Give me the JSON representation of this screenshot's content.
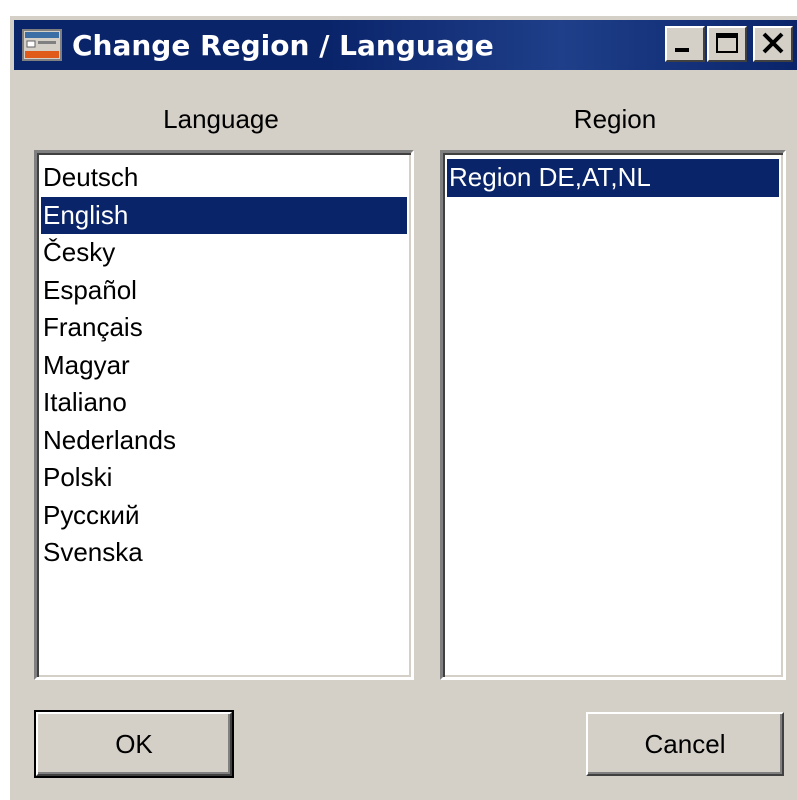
{
  "window": {
    "title": "Change Region / Language"
  },
  "language": {
    "label": "Language",
    "items": [
      "Deutsch",
      "English",
      "Česky",
      "Español",
      "Français",
      "Magyar",
      "Italiano",
      "Nederlands",
      "Polski",
      "Русский",
      "Svenska"
    ],
    "selected": "English"
  },
  "region": {
    "label": "Region",
    "items": [
      "Region DE,AT,NL"
    ],
    "selected": "Region DE,AT,NL"
  },
  "buttons": {
    "ok_label": "OK",
    "cancel_label": "Cancel"
  },
  "colors": {
    "titlebar": "#0a246a",
    "dialog_face": "#d4d0c8",
    "selection": "#0a246a"
  },
  "icons": {
    "app": "app-window-icon",
    "minimize": "minimize-icon",
    "maximize": "maximize-icon",
    "close": "close-icon"
  }
}
